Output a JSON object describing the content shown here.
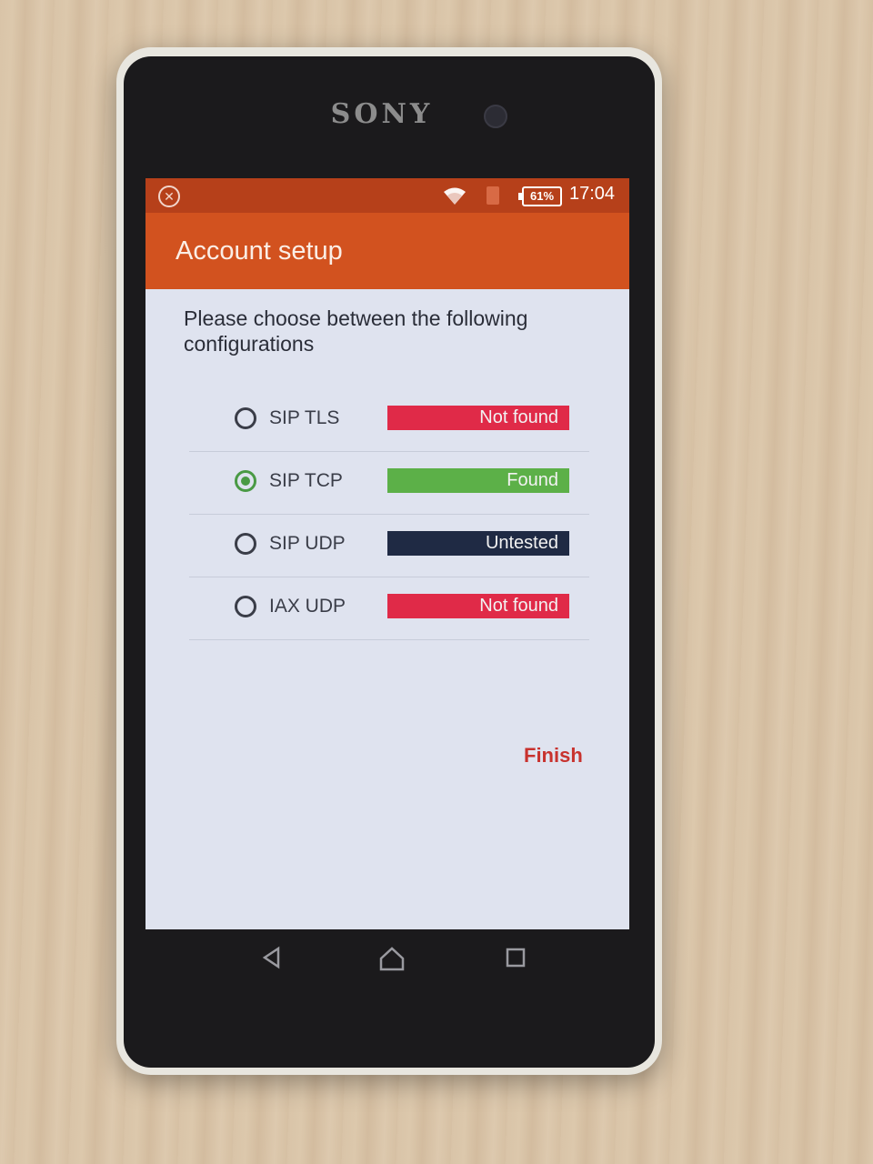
{
  "device": {
    "brand": "SONY"
  },
  "status_bar": {
    "battery": "61%",
    "time": "17:04",
    "icons": [
      "close-circle-icon",
      "wifi-icon",
      "sim-icon",
      "battery-icon"
    ]
  },
  "app_bar": {
    "title": "Account setup"
  },
  "main": {
    "instructions": "Please choose between the following configurations",
    "options": [
      {
        "label": "SIP TLS",
        "status": "Not found",
        "status_color": "#e02a48",
        "selected": false
      },
      {
        "label": "SIP TCP",
        "status": "Found",
        "status_color": "#5cb048",
        "selected": true
      },
      {
        "label": "SIP UDP",
        "status": "Untested",
        "status_color": "#1f2a44",
        "selected": false
      },
      {
        "label": "IAX UDP",
        "status": "Not found",
        "status_color": "#e02a48",
        "selected": false
      }
    ],
    "finish_label": "Finish"
  },
  "colors": {
    "status_bar": "#b6401a",
    "app_bar": "#d2521f",
    "accent": "#c8322e",
    "selected_radio": "#4a9a45"
  },
  "nav_bar": {
    "icons": [
      "back-icon",
      "home-icon",
      "recent-apps-icon"
    ]
  }
}
